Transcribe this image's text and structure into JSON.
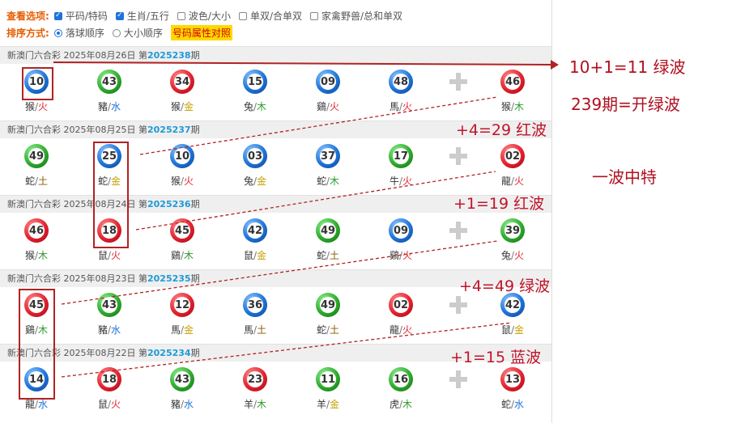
{
  "options": {
    "view_label": "查看选项:",
    "view_items": [
      {
        "label": "平码/特码",
        "checked": true
      },
      {
        "label": "生肖/五行",
        "checked": true
      },
      {
        "label": "波色/大小",
        "checked": false
      },
      {
        "label": "单双/合单双",
        "checked": false
      },
      {
        "label": "家禽野兽/总和单双",
        "checked": false
      }
    ],
    "sort_label": "排序方式:",
    "sort_items": [
      {
        "label": "落球顺序",
        "selected": true
      },
      {
        "label": "大小顺序",
        "selected": false
      }
    ],
    "attr_link": "号码属性对照"
  },
  "draws": [
    {
      "title_prefix": "新澳门六合彩 2025年08月26日 第",
      "issue": "2025238",
      "suffix": "期",
      "balls": [
        {
          "num": "10",
          "color": "blue",
          "zodiac": "猴",
          "element": "火",
          "el": "h"
        },
        {
          "num": "43",
          "color": "green",
          "zodiac": "豬",
          "element": "水",
          "el": "s"
        },
        {
          "num": "34",
          "color": "red",
          "zodiac": "猴",
          "element": "金",
          "el": "j"
        },
        {
          "num": "15",
          "color": "blue",
          "zodiac": "兔",
          "element": "木",
          "el": "m"
        },
        {
          "num": "09",
          "color": "blue",
          "zodiac": "鷄",
          "element": "火",
          "el": "h"
        },
        {
          "num": "48",
          "color": "blue",
          "zodiac": "馬",
          "element": "火",
          "el": "h"
        }
      ],
      "special": {
        "num": "46",
        "color": "red",
        "zodiac": "猴",
        "element": "木",
        "el": "m"
      }
    },
    {
      "title_prefix": "新澳门六合彩 2025年08月25日 第",
      "issue": "2025237",
      "suffix": "期",
      "balls": [
        {
          "num": "49",
          "color": "green",
          "zodiac": "蛇",
          "element": "土",
          "el": "t"
        },
        {
          "num": "25",
          "color": "blue",
          "zodiac": "蛇",
          "element": "金",
          "el": "j"
        },
        {
          "num": "10",
          "color": "blue",
          "zodiac": "猴",
          "element": "火",
          "el": "h"
        },
        {
          "num": "03",
          "color": "blue",
          "zodiac": "兔",
          "element": "金",
          "el": "j"
        },
        {
          "num": "37",
          "color": "blue",
          "zodiac": "蛇",
          "element": "木",
          "el": "m"
        },
        {
          "num": "17",
          "color": "green",
          "zodiac": "牛",
          "element": "火",
          "el": "h"
        }
      ],
      "special": {
        "num": "02",
        "color": "red",
        "zodiac": "龍",
        "element": "火",
        "el": "h"
      }
    },
    {
      "title_prefix": "新澳门六合彩 2025年08月24日 第",
      "issue": "2025236",
      "suffix": "期",
      "balls": [
        {
          "num": "46",
          "color": "red",
          "zodiac": "猴",
          "element": "木",
          "el": "m"
        },
        {
          "num": "18",
          "color": "red",
          "zodiac": "鼠",
          "element": "火",
          "el": "h"
        },
        {
          "num": "45",
          "color": "red",
          "zodiac": "鷄",
          "element": "木",
          "el": "m"
        },
        {
          "num": "42",
          "color": "blue",
          "zodiac": "鼠",
          "element": "金",
          "el": "j"
        },
        {
          "num": "49",
          "color": "green",
          "zodiac": "蛇",
          "element": "土",
          "el": "t"
        },
        {
          "num": "09",
          "color": "blue",
          "zodiac": "鷄",
          "element": "火",
          "el": "h"
        }
      ],
      "special": {
        "num": "39",
        "color": "green",
        "zodiac": "兔",
        "element": "火",
        "el": "h"
      }
    },
    {
      "title_prefix": "新澳门六合彩 2025年08月23日 第",
      "issue": "2025235",
      "suffix": "期",
      "balls": [
        {
          "num": "45",
          "color": "red",
          "zodiac": "鷄",
          "element": "木",
          "el": "m"
        },
        {
          "num": "43",
          "color": "green",
          "zodiac": "豬",
          "element": "水",
          "el": "s"
        },
        {
          "num": "12",
          "color": "red",
          "zodiac": "馬",
          "element": "金",
          "el": "j"
        },
        {
          "num": "36",
          "color": "blue",
          "zodiac": "馬",
          "element": "土",
          "el": "t"
        },
        {
          "num": "49",
          "color": "green",
          "zodiac": "蛇",
          "element": "土",
          "el": "t"
        },
        {
          "num": "02",
          "color": "red",
          "zodiac": "龍",
          "element": "火",
          "el": "h"
        }
      ],
      "special": {
        "num": "42",
        "color": "blue",
        "zodiac": "鼠",
        "element": "金",
        "el": "j"
      }
    },
    {
      "title_prefix": "新澳门六合彩 2025年08月22日 第",
      "issue": "2025234",
      "suffix": "期",
      "balls": [
        {
          "num": "14",
          "color": "blue",
          "zodiac": "龍",
          "element": "水",
          "el": "s"
        },
        {
          "num": "18",
          "color": "red",
          "zodiac": "鼠",
          "element": "火",
          "el": "h"
        },
        {
          "num": "43",
          "color": "green",
          "zodiac": "豬",
          "element": "水",
          "el": "s"
        },
        {
          "num": "23",
          "color": "red",
          "zodiac": "羊",
          "element": "木",
          "el": "m"
        },
        {
          "num": "11",
          "color": "green",
          "zodiac": "羊",
          "element": "金",
          "el": "j"
        },
        {
          "num": "16",
          "color": "green",
          "zodiac": "虎",
          "element": "木",
          "el": "m"
        }
      ],
      "special": {
        "num": "13",
        "color": "red",
        "zodiac": "蛇",
        "element": "水",
        "el": "s"
      }
    }
  ],
  "annotations": {
    "a1": "10+1=11 绿波",
    "a2": "239期=开绿波",
    "a3": "+4=29 红波",
    "a4": "一波中特",
    "a5": "+1=19 红波",
    "a6": "+4=49 绿波",
    "a7": "+1=15 蓝波"
  },
  "colors": {
    "red": "#e2232f",
    "green": "#2eaa2e",
    "blue": "#1e73d9",
    "annotation": "#c0152a"
  }
}
